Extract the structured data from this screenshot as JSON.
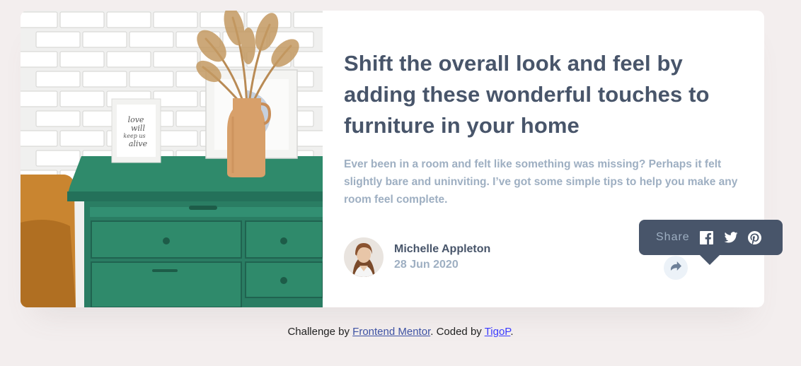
{
  "article": {
    "title": "Shift the overall look and feel by adding these wonderful touches to furniture in your home",
    "description": "Ever been in a room and felt like something was missing? Perhaps it felt slightly bare and uninviting. I’ve got some simple tips to help you make any room feel complete.",
    "image_icon": "drawers-photo",
    "frame_text": [
      "love",
      "will",
      "keep us",
      "alive"
    ]
  },
  "author": {
    "name": "Michelle Appleton",
    "date": "28 Jun 2020",
    "avatar_icon": "avatar-michelle"
  },
  "share": {
    "label": "Share",
    "icons": [
      "facebook-icon",
      "twitter-icon",
      "pinterest-icon"
    ],
    "button_icon": "share-icon"
  },
  "footer": {
    "prefix": "Challenge by ",
    "link1": "Frontend Mentor",
    "middle": ". Coded by ",
    "link2": "TigoP",
    "suffix": "."
  },
  "colors": {
    "background": "#f3eeee",
    "dark_blue": "#48556a",
    "grayish_blue": "#9eafc2",
    "light_blue": "#ecf2f8",
    "drawer_green": "#2d8167"
  }
}
